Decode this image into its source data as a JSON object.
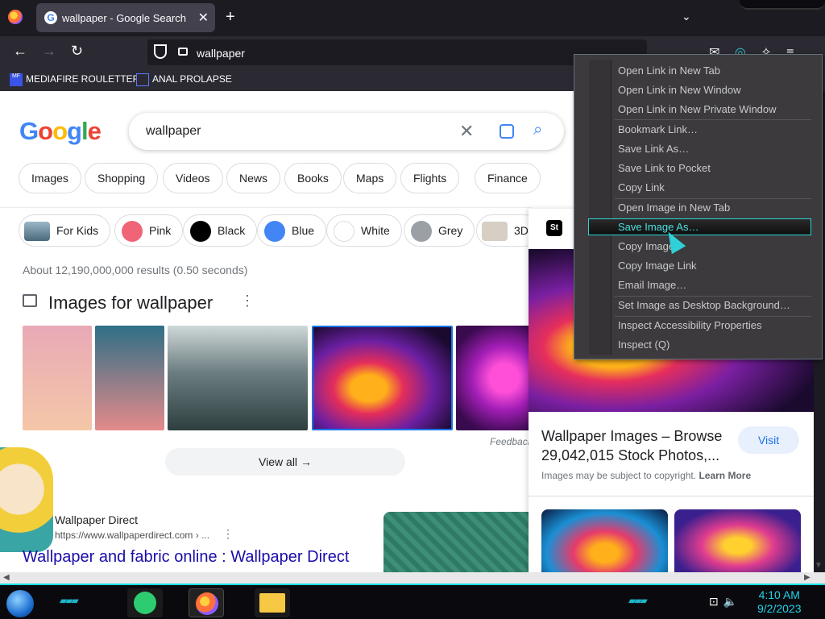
{
  "browser": {
    "tab": {
      "title": "wallpaper - Google Search",
      "favicon": "G"
    },
    "url": "wallpaper",
    "bookmarks": [
      {
        "label": "MEDIAFIRE ROULETTER",
        "icon": "MF"
      },
      {
        "label": "ANAL PROLAPSE"
      }
    ]
  },
  "google": {
    "logo": [
      "G",
      "o",
      "o",
      "g",
      "l",
      "e"
    ],
    "logo_colors": [
      "#4285f4",
      "#ea4335",
      "#fbbc05",
      "#4285f4",
      "#34a853",
      "#ea4335"
    ],
    "query": "wallpaper",
    "filters": [
      "Images",
      "Shopping",
      "Videos",
      "News",
      "Books",
      "Maps",
      "Flights",
      "Finance"
    ],
    "refine": [
      {
        "label": "For Kids",
        "color": "#6e8ea8"
      },
      {
        "label": "Pink",
        "color": "#f06478"
      },
      {
        "label": "Black",
        "color": "#000000"
      },
      {
        "label": "Blue",
        "color": "#4285f4"
      },
      {
        "label": "White",
        "color": "#ffffff"
      },
      {
        "label": "Grey",
        "color": "#9aa0a6"
      },
      {
        "label": "3D",
        "color": "#d7cfc4"
      }
    ],
    "results_count": "About 12,190,000,000 results (0.50 seconds)",
    "images_heading": "Images for wallpaper",
    "feedback": "Feedback",
    "view_all": "View all",
    "result": {
      "site_name": "Wallpaper Direct",
      "site_url": "https://www.wallpaperdirect.com › ...",
      "title": "Wallpaper and fabric online : Wallpaper Direct"
    }
  },
  "panel": {
    "badge": "St",
    "title": "Wallpaper Images – Browse 29,042,015 Stock Photos,...",
    "visit": "Visit",
    "copyright": "Images may be subject to copyright.",
    "learn_more": "Learn More"
  },
  "context_menu": {
    "items": [
      "Open Link in New Tab",
      "Open Link in New Window",
      "Open Link in New Private Window",
      "Bookmark Link…",
      "Save Link As…",
      "Save Link to Pocket",
      "Copy Link",
      "Open Image in New Tab",
      "Save Image As…",
      "Copy Image",
      "Copy Image Link",
      "Email Image…",
      "Set Image as Desktop Background…",
      "Inspect Accessibility Properties",
      "Inspect (Q)"
    ],
    "highlighted": "Save Image As…"
  },
  "taskbar": {
    "time": "4:10 AM",
    "date": "9/2/2023"
  }
}
